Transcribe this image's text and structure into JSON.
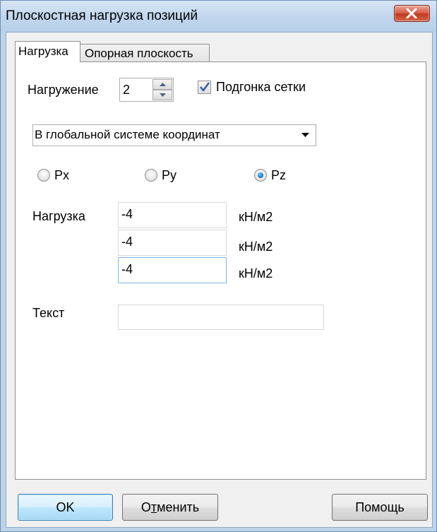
{
  "window": {
    "title": "Плоскостная нагрузка позиций"
  },
  "tabs": [
    {
      "label": "Нагрузка",
      "active": true
    },
    {
      "label": "Опорная плоскость",
      "active": false
    }
  ],
  "loading": {
    "label": "Нагружение",
    "value": "2"
  },
  "grid_fit": {
    "label": "Подгонка сетки",
    "checked": true
  },
  "coord_system": {
    "selected": "В глобальной системе координат"
  },
  "components": [
    {
      "label": "Px",
      "selected": false
    },
    {
      "label": "Py",
      "selected": false
    },
    {
      "label": "Pz",
      "selected": true
    }
  ],
  "load": {
    "label": "Нагрузка",
    "rows": [
      {
        "value": "-4",
        "unit": "кН/м2"
      },
      {
        "value": "-4",
        "unit": "кН/м2"
      },
      {
        "value": "-4",
        "unit": "кН/м2"
      }
    ]
  },
  "text": {
    "label": "Текст",
    "value": ""
  },
  "buttons": {
    "ok": "OK",
    "cancel_prefix": "О",
    "cancel_underlined": "т",
    "cancel_rest": "менить",
    "help": "Помощь"
  },
  "icons": {
    "close": "close-icon",
    "spin_up": "triangle-up-icon",
    "spin_down": "triangle-down-icon",
    "check": "checkmark-icon",
    "dropdown": "triangle-down-icon"
  },
  "colors": {
    "titlebar": "#c2d7ee",
    "close_button": "#c23a21",
    "dialog_bg": "#f0f0f0",
    "radio_selected": "#1b7fcf",
    "default_button": "#bee6fd"
  }
}
